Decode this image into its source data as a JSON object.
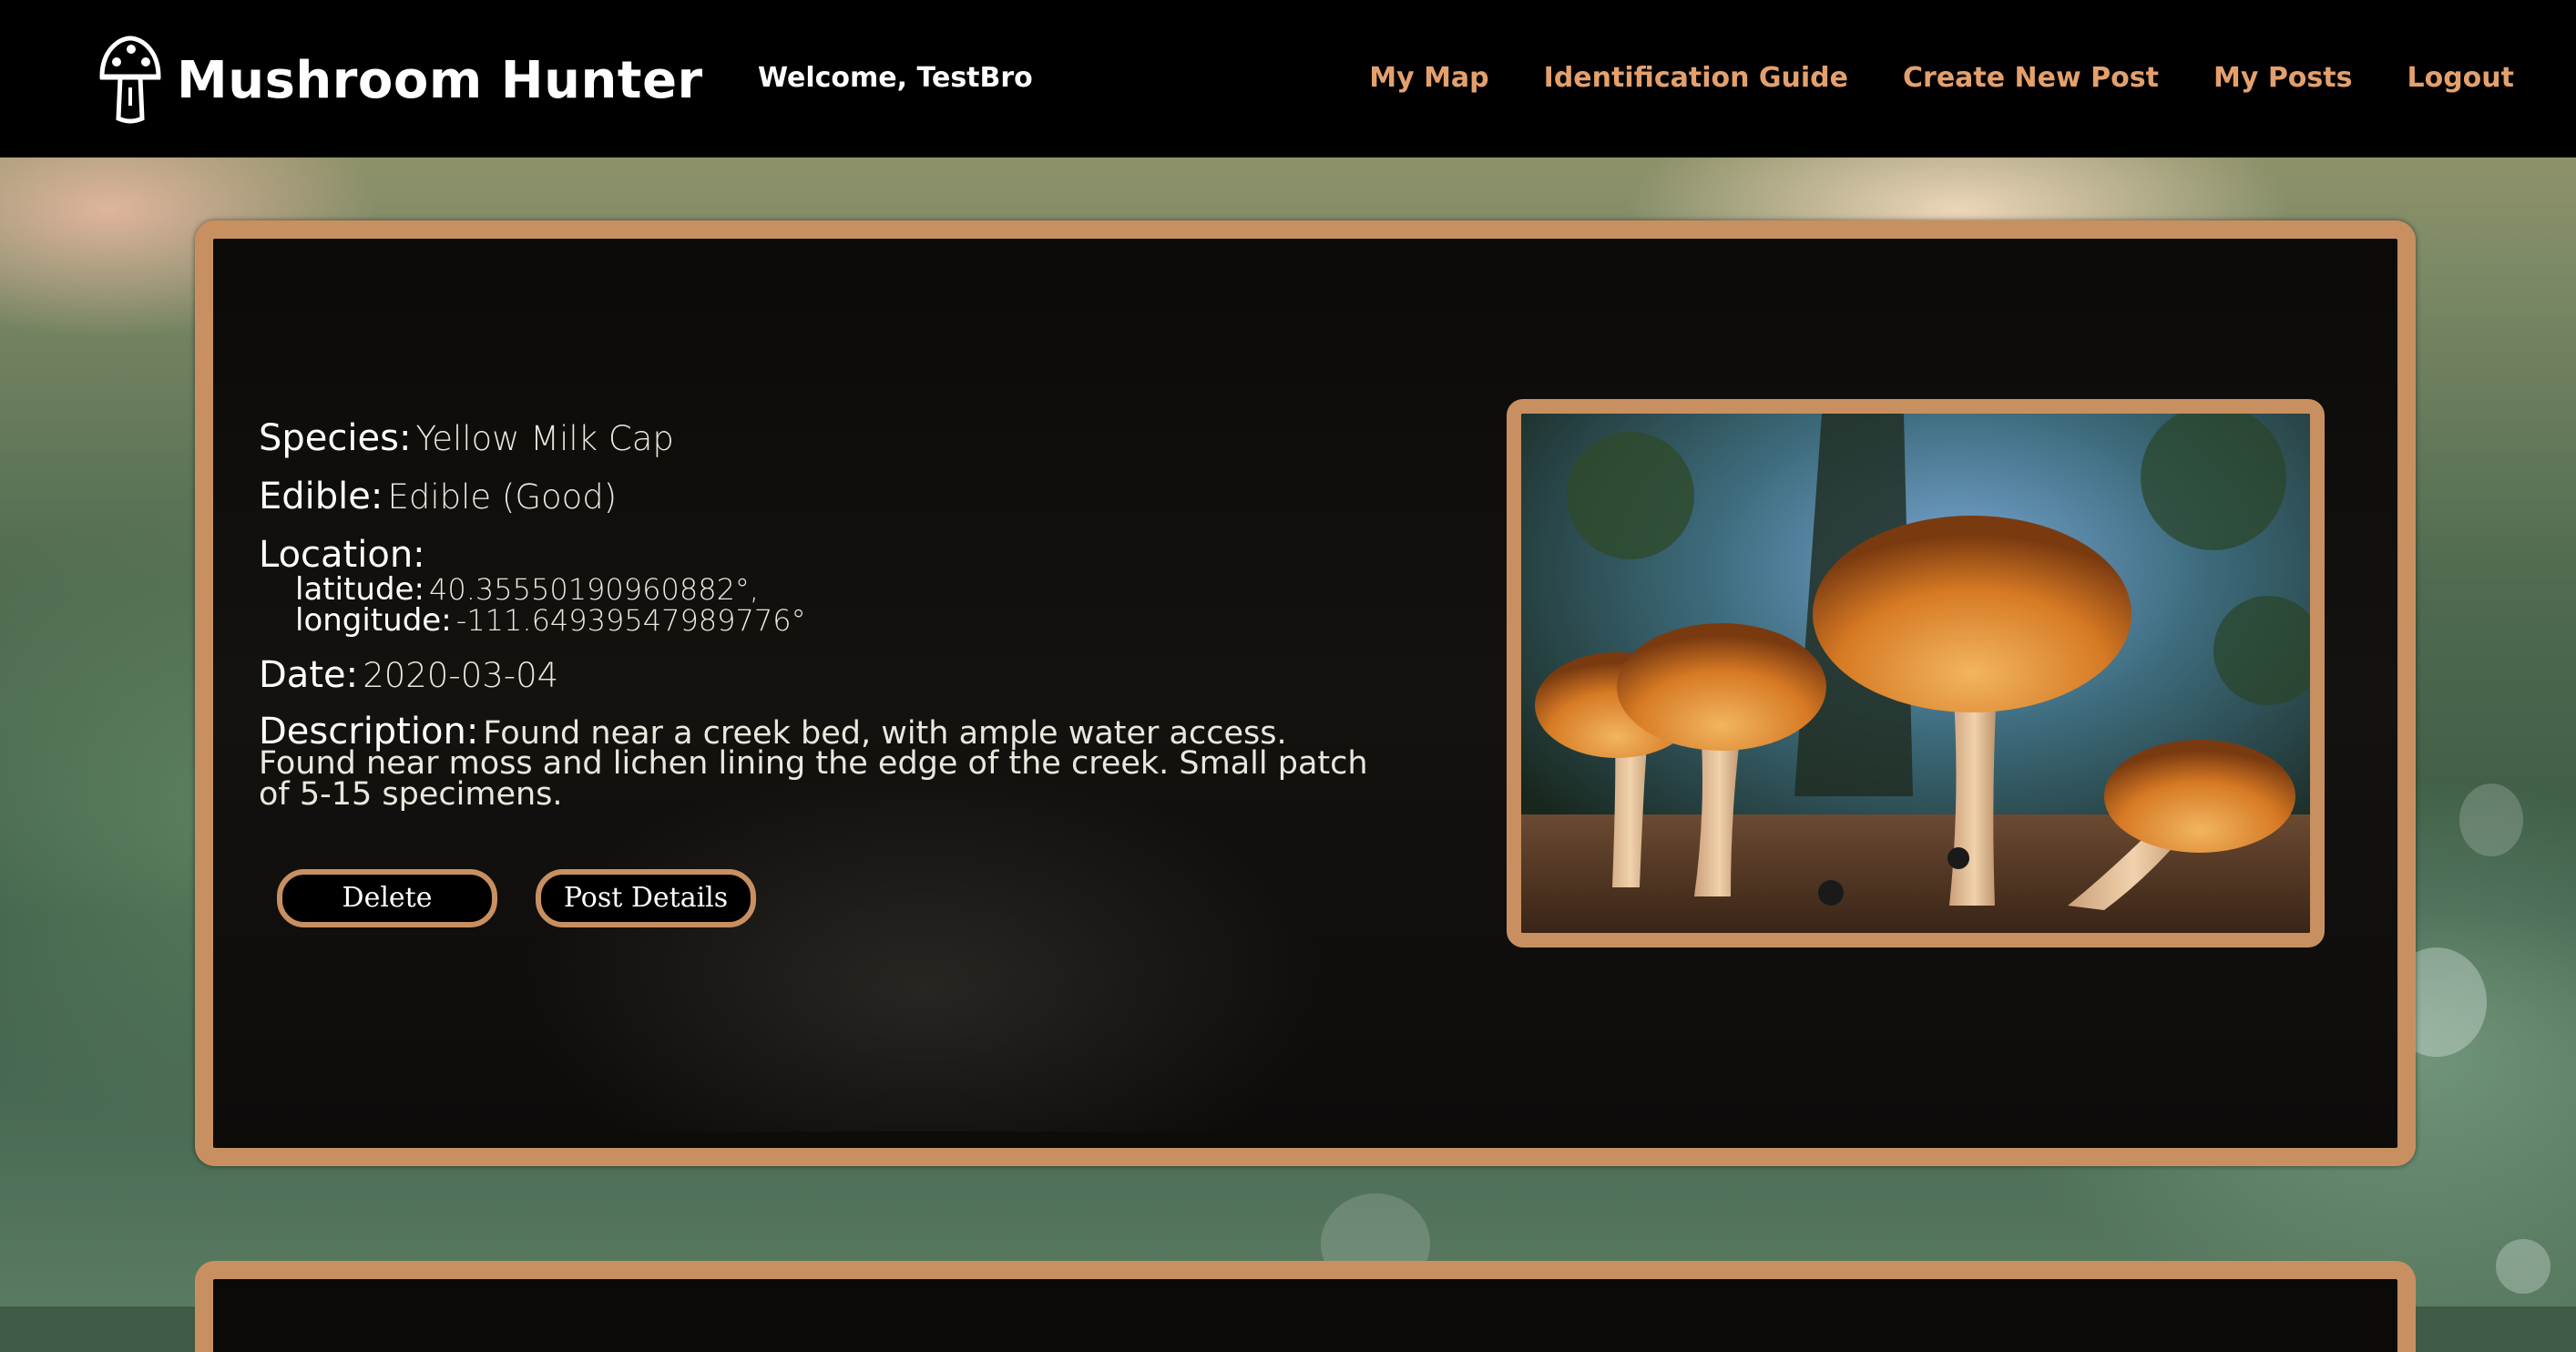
{
  "app": {
    "title": "Mushroom Hunter",
    "logo_icon": "mushroom-icon",
    "welcome": "Welcome, TestBro"
  },
  "nav": [
    {
      "label": "My Map"
    },
    {
      "label": "Identification Guide"
    },
    {
      "label": "Create New Post"
    },
    {
      "label": "My Posts"
    },
    {
      "label": "Logout"
    }
  ],
  "post": {
    "species_label": "Species:",
    "species": "Yellow Milk Cap",
    "edible_label": "Edible:",
    "edible": "Edible (Good)",
    "location_label": "Location:",
    "latitude_label": "latitude:",
    "latitude": "40.35550190960882°,",
    "longitude_label": "longitude:",
    "longitude": "-111.64939547989776°",
    "date_label": "Date:",
    "date": "2020-03-04",
    "description_label": "Description:",
    "description": "Found near a creek bed, with ample water access. Found near moss and lichen lining the edge of the creek. Small patch of 5-15 specimens.",
    "delete_label": "Delete",
    "details_label": "Post Details"
  },
  "colors": {
    "accent": "#c89060",
    "nav_link": "#e4a06c",
    "header_bg": "#000000",
    "card_bg": "#0b0a08"
  }
}
